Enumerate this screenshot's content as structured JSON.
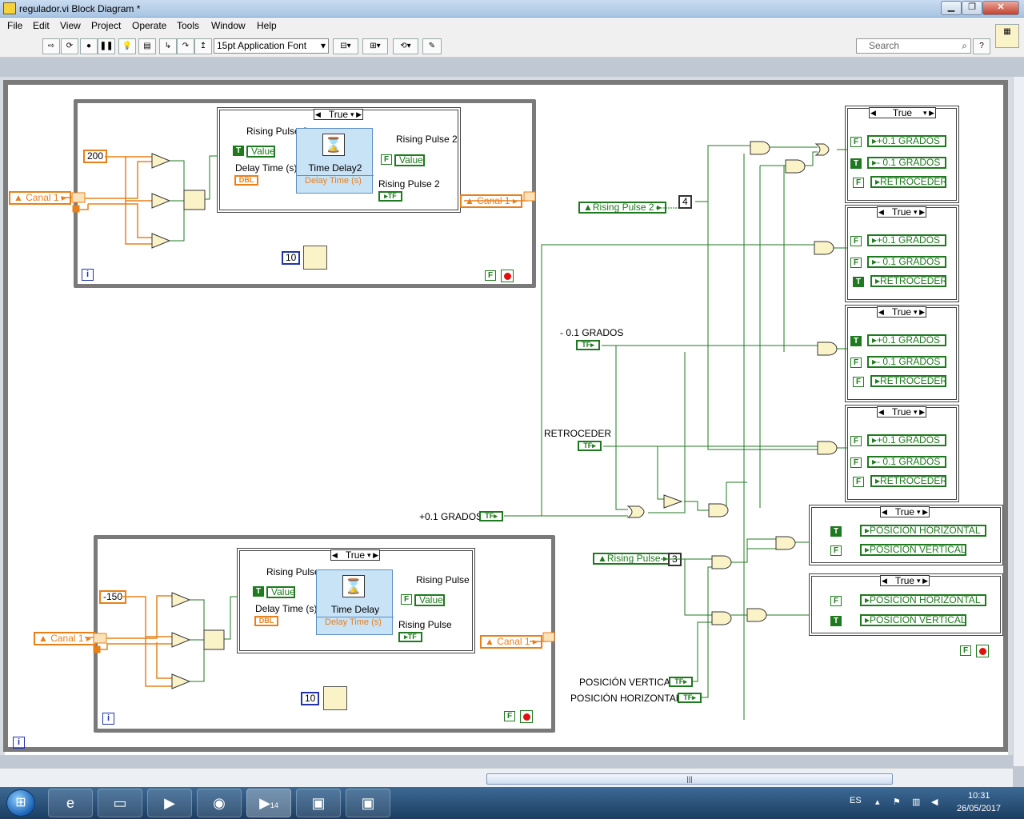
{
  "window": {
    "title": "regulador.vi Block Diagram *"
  },
  "menu": [
    "File",
    "Edit",
    "View",
    "Project",
    "Operate",
    "Tools",
    "Window",
    "Help"
  ],
  "toolbar": {
    "font": "15pt Application Font",
    "search_placeholder": "Search",
    "help": "?"
  },
  "top_loop": {
    "threshold": "200",
    "channel_in": "Canal 1",
    "channel_out": "Canal 1",
    "case": "True",
    "rising_pulse_label": "Rising Pulse 2",
    "value": "Value",
    "delay_time_label": "Delay Time (s) 2",
    "timedelay_title": "Time Delay2",
    "delay_time_port": "Delay Time (s)",
    "dbl": "DBL",
    "rising_pulse_out": "Rising Pulse 2",
    "rising_pulse_ind": "Rising Pulse 2",
    "wait_ms": "10",
    "iteration": "i",
    "stop": "F"
  },
  "bottom_loop": {
    "threshold": "-150",
    "channel_in": "Canal 1",
    "channel_out": "Canal 1",
    "case": "True",
    "rising_pulse_label": "Rising Pulse",
    "value": "Value",
    "delay_time_label": "Delay Time (s)",
    "timedelay_title": "Time Delay",
    "delay_time_port": "Delay Time (s)",
    "dbl": "DBL",
    "rising_pulse_out": "Rising Pulse",
    "rising_pulse_ind": "Rising Pulse",
    "wait_ms": "10",
    "iteration": "i",
    "stop": "F"
  },
  "right": {
    "rising_pulse2": "Rising Pulse 2",
    "const4": "4",
    "rising_pulse": "Rising Pulse",
    "const3": "3",
    "minus_label": "- 0.1 GRADOS",
    "retroceder_label": "RETROCEDER",
    "plus_label": "+0.1 GRADOS",
    "pos_vertical_label": "POSICIÓN VERTICAL",
    "pos_horizontal_label": "POSICIÓN HORIZONTAL",
    "cases": [
      {
        "sel": "True",
        "items": [
          {
            "b": "F",
            "t": "+0.1 GRADOS"
          },
          {
            "b": "T",
            "t": "- 0.1 GRADOS"
          },
          {
            "b": "F",
            "t": "RETROCEDER"
          }
        ]
      },
      {
        "sel": "True",
        "items": [
          {
            "b": "F",
            "t": "+0.1 GRADOS"
          },
          {
            "b": "F",
            "t": "- 0.1 GRADOS"
          },
          {
            "b": "T",
            "t": "RETROCEDER"
          }
        ]
      },
      {
        "sel": "True",
        "items": [
          {
            "b": "T",
            "t": "+0.1 GRADOS"
          },
          {
            "b": "F",
            "t": "- 0.1 GRADOS"
          },
          {
            "b": "F",
            "t": "RETROCEDER"
          }
        ]
      },
      {
        "sel": "True",
        "items": [
          {
            "b": "F",
            "t": "+0.1 GRADOS"
          },
          {
            "b": "F",
            "t": "- 0.1 GRADOS"
          },
          {
            "b": "F",
            "t": "RETROCEDER"
          }
        ]
      },
      {
        "sel": "True",
        "items": [
          {
            "b": "T",
            "t": "POSICIÓN HORIZONTAL"
          },
          {
            "b": "F",
            "t": "POSICIÓN VERTICAL"
          }
        ]
      },
      {
        "sel": "True",
        "items": [
          {
            "b": "F",
            "t": "POSICIÓN HORIZONTAL"
          },
          {
            "b": "T",
            "t": "POSICIÓN VERTICAL"
          }
        ]
      }
    ],
    "stop": "F",
    "outer_iteration": "i"
  },
  "taskbar": {
    "lang": "ES",
    "time": "10:31",
    "date": "26/05/2017",
    "lv_badge": "14"
  }
}
